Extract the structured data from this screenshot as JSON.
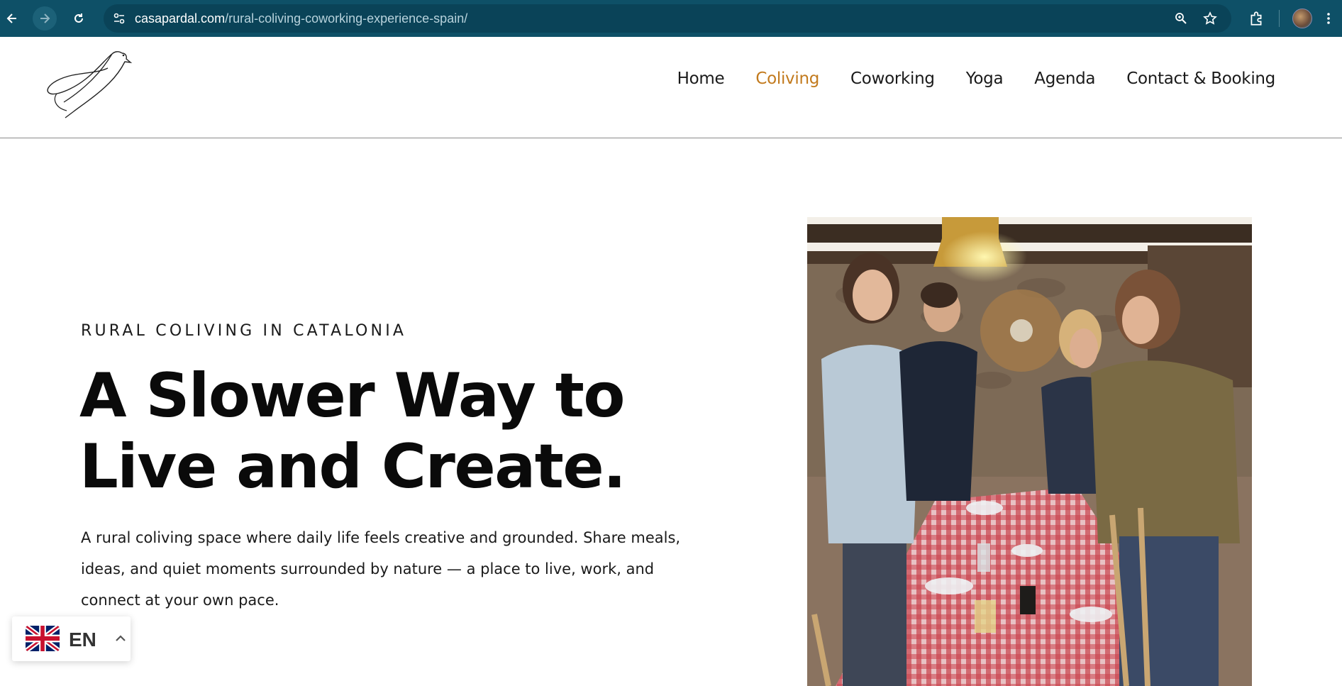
{
  "browser": {
    "url_domain": "casapardal.com",
    "url_path": "/rural-coliving-coworking-experience-spain/",
    "icons": [
      "back-icon",
      "forward-icon",
      "reload-icon",
      "site-info-icon",
      "zoom-icon",
      "bookmark-star-icon",
      "extensions-icon",
      "profile-avatar",
      "more-menu-icon"
    ],
    "colors": {
      "toolbar": "#0e5067",
      "omnibox": "#0a4358"
    }
  },
  "header": {
    "logo": "bird-line-logo",
    "nav": [
      {
        "label": "Home"
      },
      {
        "label": "Coliving",
        "active": true
      },
      {
        "label": "Coworking"
      },
      {
        "label": "Yoga"
      },
      {
        "label": "Agenda"
      },
      {
        "label": "Contact & Booking"
      }
    ],
    "colors": {
      "active_nav": "#c27a1d",
      "nav": "#1a1a1a"
    }
  },
  "hero": {
    "eyebrow": "RURAL COLIVING IN CATALONIA",
    "title_line1": "A Slower Way to",
    "title_line2": "Live and Create.",
    "description": "A rural coliving space where daily life feels creative and grounded. Share meals, ideas, and quiet moments surrounded by nature — a place to live, work, and connect at your own pace.",
    "image": "people-sharing-meal-photo"
  },
  "language_switcher": {
    "code": "EN",
    "flag": "uk-flag-icon",
    "caret": "chevron-up-icon"
  }
}
